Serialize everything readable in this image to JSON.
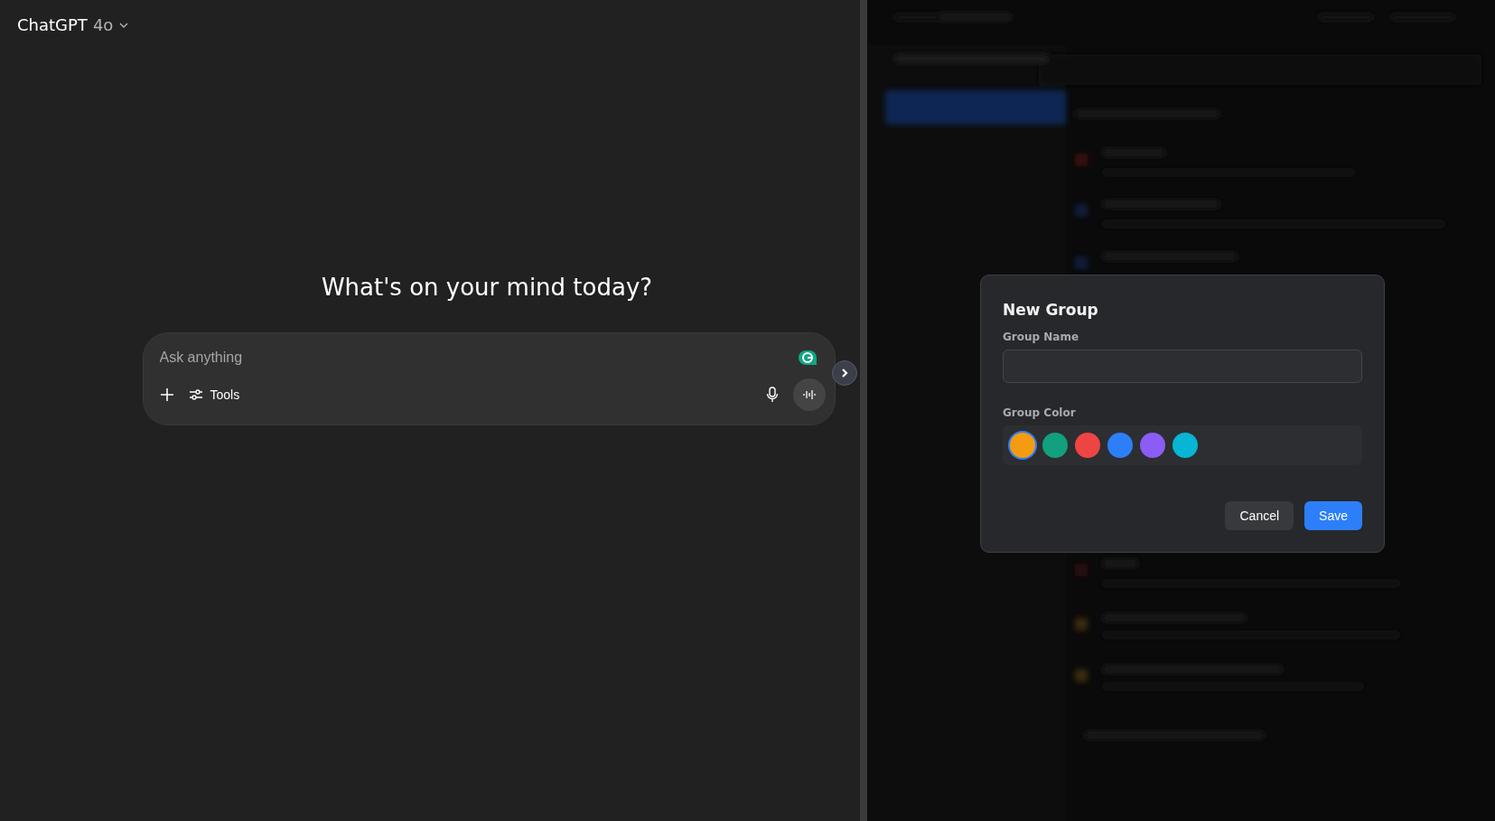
{
  "header": {
    "model_name": "ChatGPT",
    "model_version": "4o"
  },
  "heading": "What's on your mind today?",
  "composer": {
    "placeholder": "Ask anything",
    "tools_label": "Tools"
  },
  "dialog": {
    "title": "New Group",
    "name_label": "Group Name",
    "color_label": "Group Color",
    "colors": [
      {
        "color": "#f39c12",
        "selected": true
      },
      {
        "color": "#12a07e",
        "selected": false
      },
      {
        "color": "#ef4444",
        "selected": false
      },
      {
        "color": "#2d7ff9",
        "selected": false
      },
      {
        "color": "#8b5cf6",
        "selected": false
      },
      {
        "color": "#06b6d4",
        "selected": false
      }
    ],
    "buttons": [
      {
        "label": "Cancel",
        "kind": "secondary"
      },
      {
        "label": "Save",
        "kind": "primary"
      }
    ]
  }
}
